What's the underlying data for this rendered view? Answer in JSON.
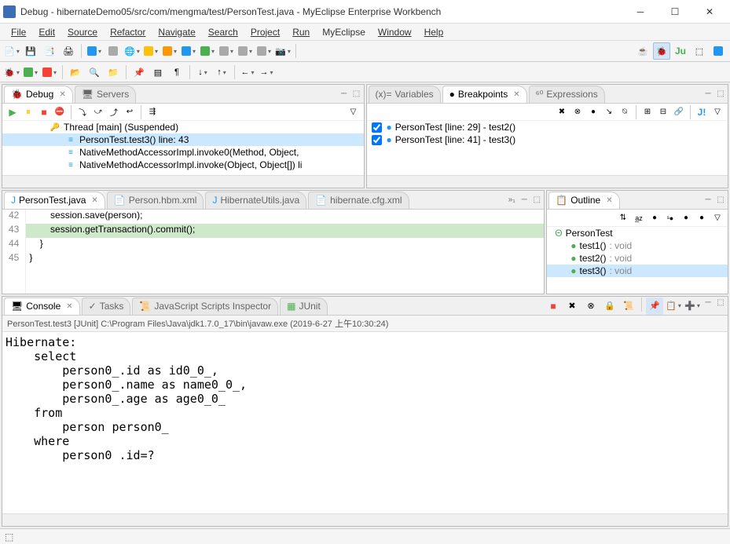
{
  "window": {
    "title": "Debug - hibernateDemo05/src/com/mengma/test/PersonTest.java - MyEclipse Enterprise Workbench"
  },
  "menu": {
    "file": "File",
    "edit": "Edit",
    "source": "Source",
    "refactor": "Refactor",
    "navigate": "Navigate",
    "search": "Search",
    "project": "Project",
    "run": "Run",
    "myeclipse": "MyEclipse",
    "window": "Window",
    "help": "Help"
  },
  "debugPanel": {
    "tab1": "Debug",
    "tab2": "Servers",
    "thread": "Thread [main] (Suspended)",
    "frame1": "PersonTest.test3() line: 43",
    "frame2": "NativeMethodAccessorImpl.invoke0(Method, Object,",
    "frame3": "NativeMethodAccessorImpl.invoke(Object, Object[]) li"
  },
  "varsPanel": {
    "tab1": "Variables",
    "tab2": "Breakpoints",
    "tab3": "Expressions",
    "bp1": "PersonTest [line: 29] - test2()",
    "bp2": "PersonTest [line: 41] - test3()"
  },
  "editors": {
    "tab1": "PersonTest.java",
    "tab2": "Person.hbm.xml",
    "tab3": "HibernateUtils.java",
    "tab4": "hibernate.cfg.xml",
    "lines": {
      "n42": "42",
      "n43": "43",
      "n44": "44",
      "n45": "45",
      "l42": "        session.save(person);",
      "l43": "        session.getTransaction().commit();",
      "l44": "    }",
      "l45": "}"
    }
  },
  "outline": {
    "tab": "Outline",
    "class": "PersonTest",
    "m1": "test1()",
    "m1r": " : void",
    "m2": "test2()",
    "m2r": " : void",
    "m3": "test3()",
    "m3r": " : void"
  },
  "console": {
    "tab1": "Console",
    "tab2": "Tasks",
    "tab3": "JavaScript Scripts Inspector",
    "tab4": "JUnit",
    "header": "PersonTest.test3 [JUnit] C:\\Program Files\\Java\\jdk1.7.0_17\\bin\\javaw.exe (2019-6-27 上午10:30:24)",
    "text": "Hibernate: \n    select\n        person0_.id as id0_0_,\n        person0_.name as name0_0_,\n        person0_.age as age0_0_ \n    from\n        person person0_ \n    where\n        person0 .id=?"
  }
}
